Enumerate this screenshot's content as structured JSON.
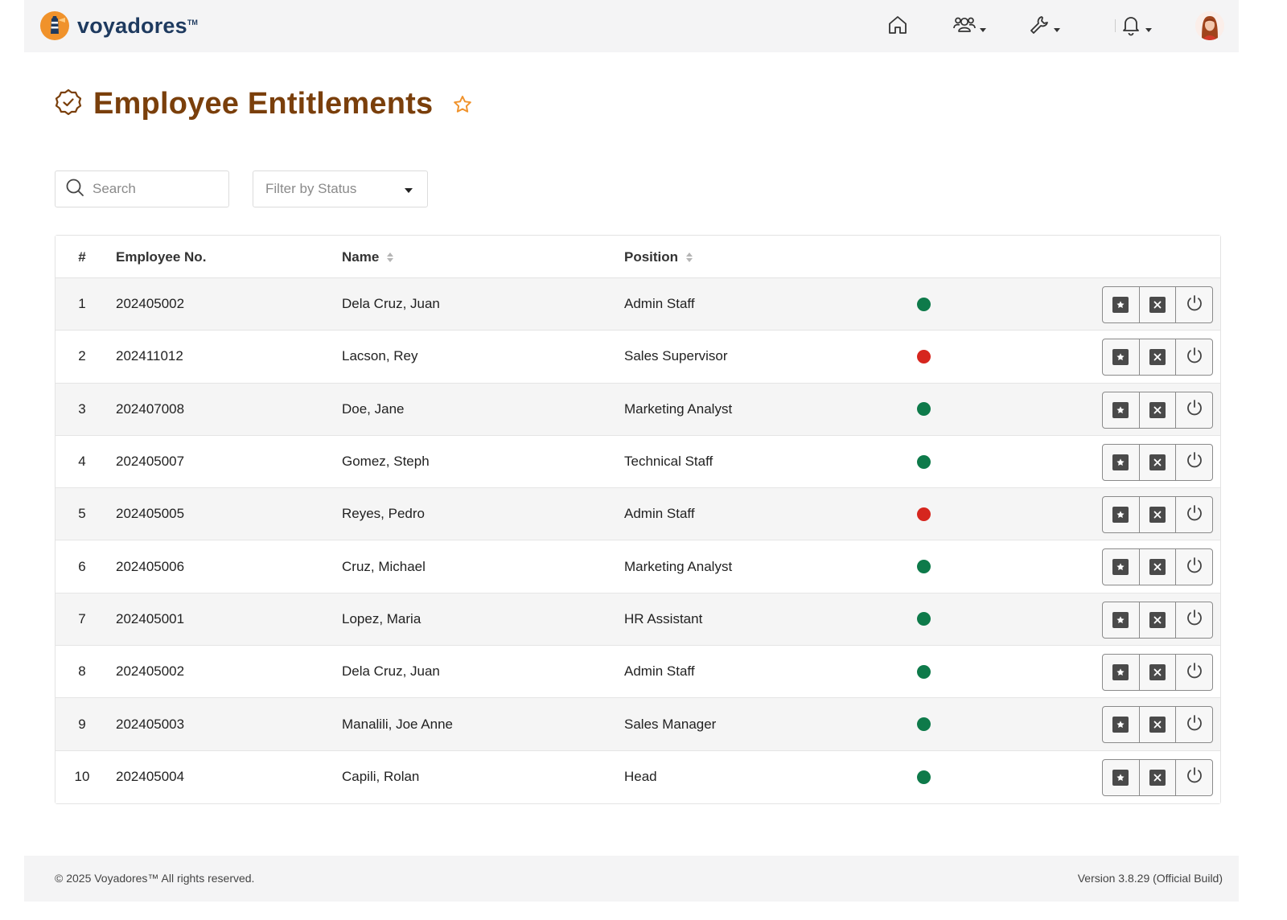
{
  "header": {
    "brand": "voyadores",
    "brand_tm": "TM",
    "nav_icons": [
      "home-icon",
      "users-icon",
      "wrench-icon",
      "bell-icon"
    ]
  },
  "page": {
    "title": "Employee Entitlements"
  },
  "filters": {
    "search_placeholder": "Search",
    "status_placeholder": "Filter by Status"
  },
  "table": {
    "columns": {
      "num": "#",
      "employee_no": "Employee No.",
      "name": "Name",
      "position": "Position"
    },
    "rows": [
      {
        "num": "1",
        "employee_no": "202405002",
        "name": "Dela Cruz, Juan",
        "position": "Admin Staff",
        "status": "active"
      },
      {
        "num": "2",
        "employee_no": "202411012",
        "name": "Lacson, Rey",
        "position": "Sales Supervisor",
        "status": "inactive"
      },
      {
        "num": "3",
        "employee_no": "202407008",
        "name": "Doe, Jane",
        "position": "Marketing Analyst",
        "status": "active"
      },
      {
        "num": "4",
        "employee_no": "202405007",
        "name": "Gomez, Steph",
        "position": "Technical Staff",
        "status": "active"
      },
      {
        "num": "5",
        "employee_no": "202405005",
        "name": "Reyes, Pedro",
        "position": "Admin Staff",
        "status": "inactive"
      },
      {
        "num": "6",
        "employee_no": "202405006",
        "name": "Cruz, Michael",
        "position": "Marketing Analyst",
        "status": "active"
      },
      {
        "num": "7",
        "employee_no": "202405001",
        "name": "Lopez, Maria",
        "position": "HR Assistant",
        "status": "active"
      },
      {
        "num": "8",
        "employee_no": "202405002",
        "name": "Dela Cruz, Juan",
        "position": "Admin Staff",
        "status": "active"
      },
      {
        "num": "9",
        "employee_no": "202405003",
        "name": "Manalili, Joe Anne",
        "position": "Sales Manager",
        "status": "active"
      },
      {
        "num": "10",
        "employee_no": "202405004",
        "name": "Capili, Rolan",
        "position": "Head",
        "status": "active"
      }
    ]
  },
  "colors": {
    "title": "#7a3f0b",
    "brand": "#1e3a5f",
    "logo_orange": "#f0922b",
    "star": "#f0922b",
    "status_active": "#0e7a4a",
    "status_inactive": "#d6261e"
  },
  "footer": {
    "copyright": "© 2025 Voyadores™ All rights reserved.",
    "version": "Version 3.8.29 (Official Build)"
  }
}
